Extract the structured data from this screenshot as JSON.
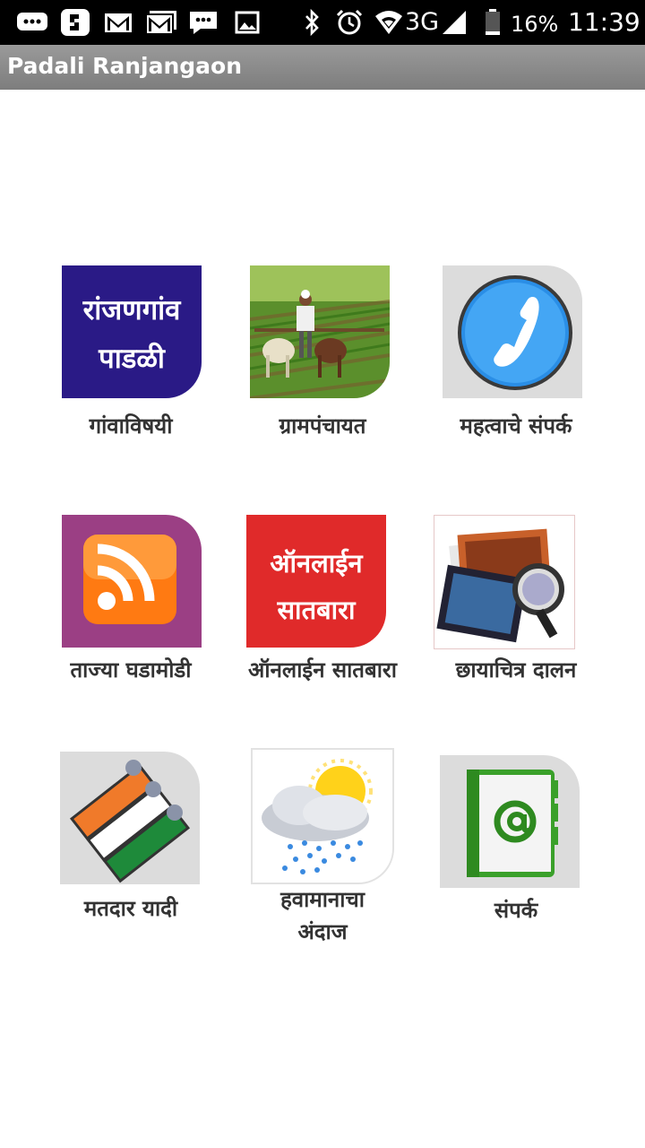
{
  "status_bar": {
    "network": "3G",
    "battery": "16%",
    "time": "11:39"
  },
  "app": {
    "title": "Padali Ranjangaon"
  },
  "tiles": [
    {
      "label": "गांवाविषयी",
      "banner_line1": "रांजणगांव",
      "banner_line2": "पाडळी",
      "icon": "village-banner-icon",
      "color": "#2a1a86"
    },
    {
      "label": "ग्रामपंचायत",
      "icon": "farmer-ploughing-icon"
    },
    {
      "label": "महत्वाचे संपर्क",
      "icon": "phone-icon",
      "color": "#2a8ee6"
    },
    {
      "label": "ताज्या घडामोडी",
      "icon": "rss-icon",
      "color": "#9b3f84"
    },
    {
      "label": "ऑनलाईन सातबारा",
      "banner_line1": "ऑनलाईन",
      "banner_line2": "सातबारा",
      "icon": "online-satbara-banner-icon",
      "color": "#e02a2a"
    },
    {
      "label": "छायाचित्र दालन",
      "icon": "photo-gallery-icon"
    },
    {
      "label": "मतदार यादी",
      "icon": "voter-list-icon"
    },
    {
      "label": "हवामानाचा अंदाज",
      "label_line1": "हवामानाचा",
      "label_line2": "अंदाज",
      "icon": "weather-icon"
    },
    {
      "label": "संपर्क",
      "icon": "contact-book-icon"
    }
  ]
}
